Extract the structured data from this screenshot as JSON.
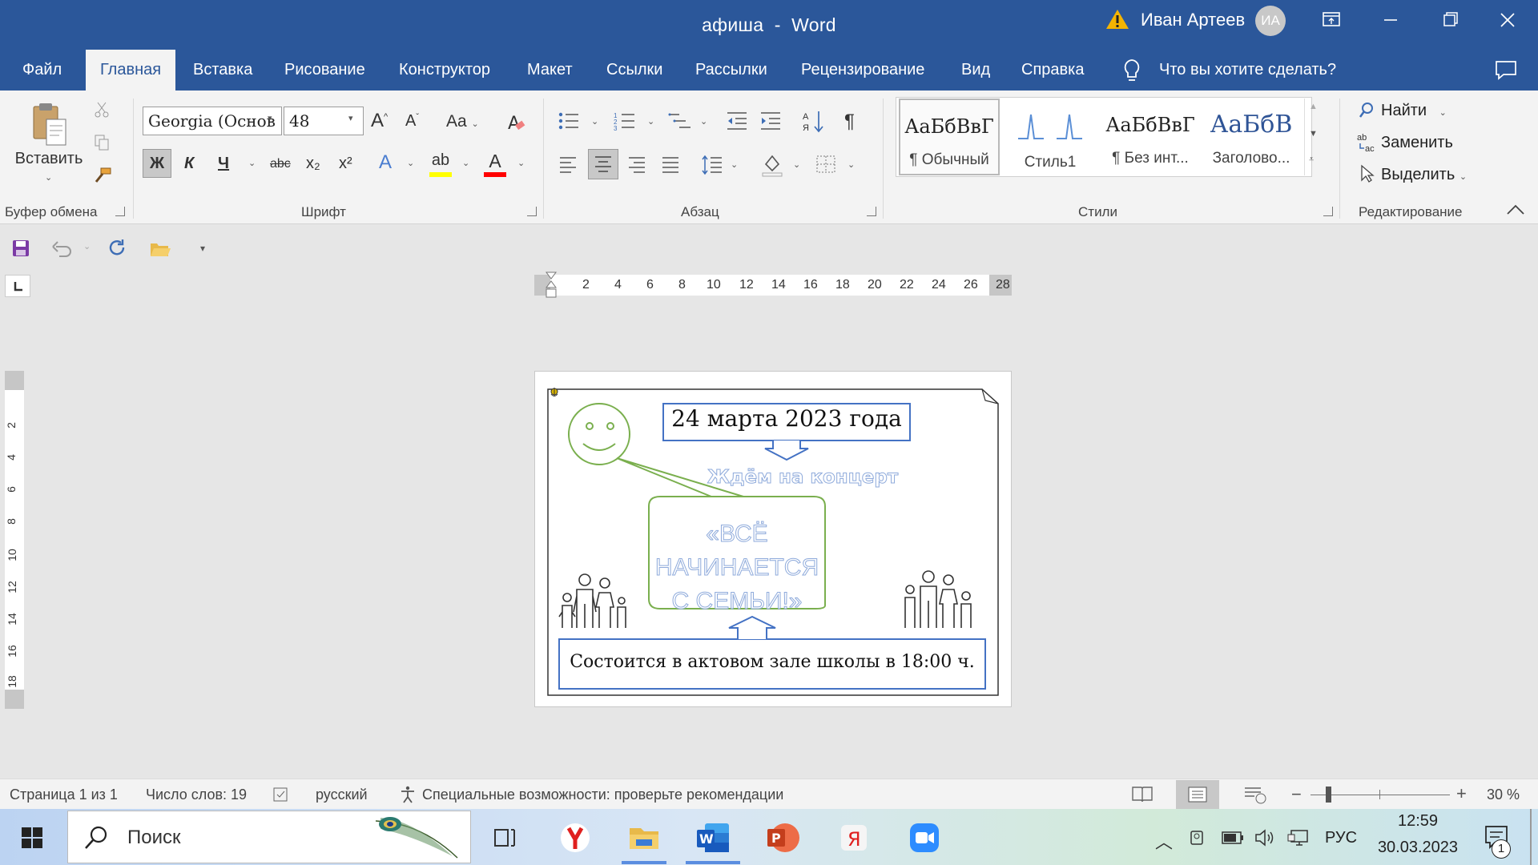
{
  "window": {
    "doc_name": "афиша",
    "app_name": "Word",
    "title_sep": "-",
    "user_name": "Иван Артеев",
    "user_initials": "ИА"
  },
  "tabs": [
    "Файл",
    "Главная",
    "Вставка",
    "Рисование",
    "Конструктор",
    "Макет",
    "Ссылки",
    "Рассылки",
    "Рецензирование",
    "Вид",
    "Справка"
  ],
  "active_tab": "Главная",
  "tell_me": "Что вы хотите сделать?",
  "ribbon": {
    "clipboard": {
      "paste_label": "Вставить",
      "group_label": "Буфер обмена"
    },
    "font": {
      "font_name": "Georgia (Основ",
      "font_size": "48",
      "grow": "A",
      "shrink": "A",
      "case": "Aa",
      "bold": "Ж",
      "italic": "К",
      "underline": "Ч",
      "strike": "abc",
      "sub": "x₂",
      "sup": "x²",
      "group_label": "Шрифт",
      "highlight_color": "#ffff00",
      "font_color": "#ff0000"
    },
    "paragraph": {
      "group_label": "Абзац",
      "pilcrow": "¶"
    },
    "styles": {
      "group_label": "Стили",
      "items": [
        {
          "preview": "АаБбВвГ",
          "name": "¶ Обычный"
        },
        {
          "preview": "",
          "name": "Стиль1"
        },
        {
          "preview": "АаБбВвГ",
          "name": "¶ Без инт..."
        },
        {
          "preview": "АаБбВ",
          "name": "Заголово..."
        }
      ]
    },
    "editing": {
      "group_label": "Редактирование",
      "find": "Найти",
      "replace": "Заменить",
      "select": "Выделить"
    }
  },
  "ruler": {
    "h_numbers": [
      "2",
      "4",
      "6",
      "8",
      "10",
      "12",
      "14",
      "16",
      "18",
      "20",
      "22",
      "24",
      "26",
      "28"
    ],
    "v_numbers": [
      "2",
      "4",
      "6",
      "8",
      "10",
      "12",
      "14",
      "16",
      "18"
    ]
  },
  "document": {
    "date": "24 марта 2023 года",
    "invite": "Ждём на концерт",
    "title_line1": "«ВСЁ НАЧИНАЕТСЯ",
    "title_line2": "С СЕМЬИ!»",
    "venue": "Состоится в актовом зале школы в 18:00 ч."
  },
  "status": {
    "page": "Страница 1 из 1",
    "words": "Число слов: 19",
    "lang": "русский",
    "access": "Специальные возможности: проверьте рекомендации",
    "zoom": "30 %"
  },
  "taskbar": {
    "search_placeholder": "Поиск",
    "lang": "РУС",
    "time": "12:59",
    "date": "30.03.2023",
    "notif_count": "1"
  },
  "colors": {
    "word_blue": "#2b579a",
    "shape_green": "#7aaf4e",
    "box_blue": "#4472c4"
  }
}
